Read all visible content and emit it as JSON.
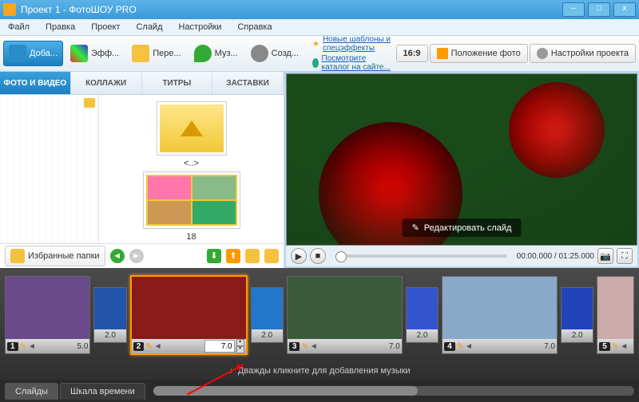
{
  "title": "Проект 1 - ФотоШОУ PRO",
  "menu": [
    "Файл",
    "Правка",
    "Проект",
    "Слайд",
    "Настройки",
    "Справка"
  ],
  "toolbar": {
    "add": "Доба...",
    "effects": "Эфф...",
    "transitions": "Пере...",
    "music": "Муз...",
    "create": "Созд...",
    "link1": "Новые шаблоны и спецэффекты",
    "link2": "Посмотрите каталог на сайте...",
    "ratio": "16:9",
    "pos": "Положение фото",
    "settings": "Настройки проекта"
  },
  "tabs": {
    "photo": "ФОТО И ВИДЕО",
    "collage": "КОЛЛАЖИ",
    "titles": "ТИТРЫ",
    "splash": "ЗАСТАВКИ"
  },
  "thumbs": {
    "up": "<..>",
    "count": "18"
  },
  "fav": "Избранные папки",
  "preview": {
    "edit": "Редактировать слайд"
  },
  "time": {
    "cur": "00:00.000",
    "total": "01:25.000"
  },
  "slides": [
    {
      "n": "1",
      "dur": "5.0",
      "img": "#6a4a8a"
    },
    {
      "n": "2",
      "dur": "7.0",
      "img": "#8a1a1a",
      "sel": true
    },
    {
      "n": "3",
      "dur": "7.0",
      "img": "#3a5a3a"
    },
    {
      "n": "4",
      "dur": "7.0",
      "img": "#8aa8c8"
    },
    {
      "n": "5",
      "dur": "",
      "img": "#caa"
    }
  ],
  "trans": [
    {
      "dur": "2.0",
      "c": "#25a"
    },
    {
      "dur": "2.0",
      "c": "#27c"
    },
    {
      "dur": "2.0",
      "c": "#35c"
    },
    {
      "dur": "2.0",
      "c": "#24b"
    }
  ],
  "dur_input": "7.0",
  "music": "Дважды кликните для добавления музыки",
  "btabs": {
    "slides": "Слайды",
    "timeline": "Шкала времени"
  }
}
